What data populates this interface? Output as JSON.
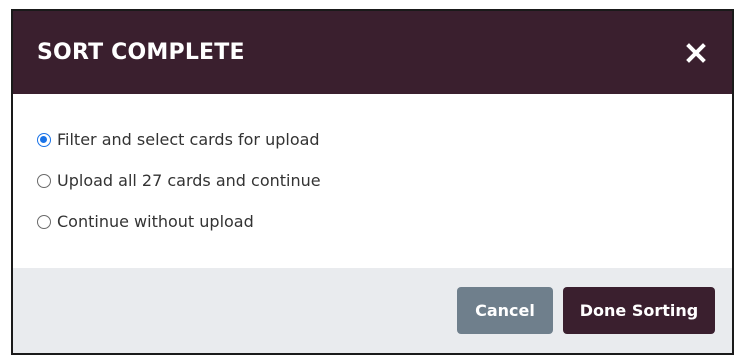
{
  "dialog": {
    "title": "SORT COMPLETE",
    "close_icon": "close-icon",
    "options": [
      {
        "label": "Filter and select cards for upload",
        "checked": true
      },
      {
        "label": "Upload all 27 cards and continue",
        "checked": false
      },
      {
        "label": "Continue without upload",
        "checked": false
      }
    ],
    "cancel_label": "Cancel",
    "done_label": "Done Sorting"
  },
  "colors": {
    "header_bg": "#3a1f2e",
    "footer_bg": "#e9ebee",
    "cancel_bg": "#6f7f8c",
    "done_bg": "#3a1f2e",
    "radio_accent": "#1a73e8"
  }
}
